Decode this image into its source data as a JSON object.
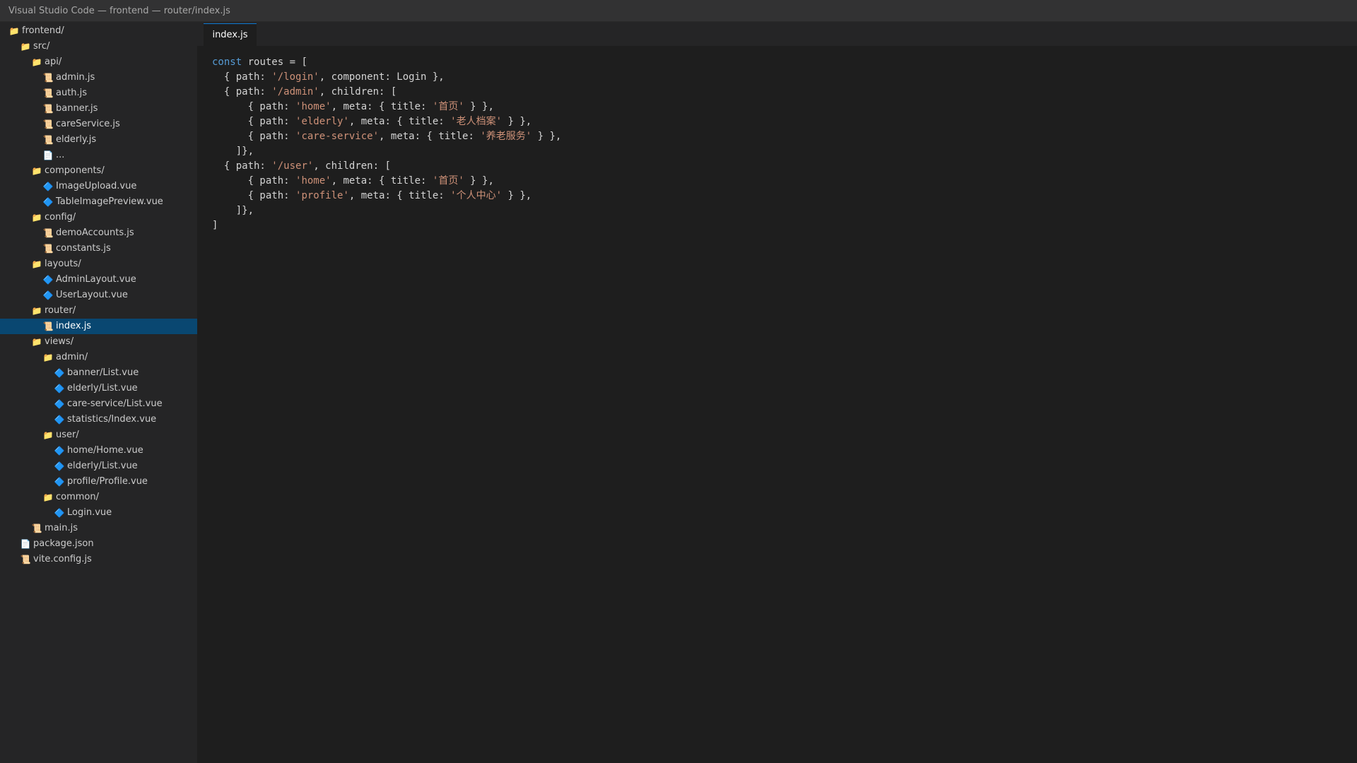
{
  "window": {
    "title": "Visual Studio Code — frontend — router/index.js"
  },
  "explorer": {
    "items": [
      {
        "label": "frontend/",
        "icon": "folder-icon",
        "depth": 0
      },
      {
        "label": "src/",
        "icon": "folder-icon",
        "depth": 1
      },
      {
        "label": "api/",
        "icon": "folder-icon",
        "depth": 2
      },
      {
        "label": "admin.js",
        "icon": "js-file-icon",
        "depth": 3
      },
      {
        "label": "auth.js",
        "icon": "js-file-icon",
        "depth": 3
      },
      {
        "label": "banner.js",
        "icon": "js-file-icon",
        "depth": 3
      },
      {
        "label": "careService.js",
        "icon": "js-file-icon",
        "depth": 3
      },
      {
        "label": "elderly.js",
        "icon": "js-file-icon",
        "depth": 3
      },
      {
        "label": "...",
        "icon": "file-icon",
        "depth": 3
      },
      {
        "label": "components/",
        "icon": "folder-icon",
        "depth": 2
      },
      {
        "label": "ImageUpload.vue",
        "icon": "vue-file-icon",
        "depth": 3
      },
      {
        "label": "TableImagePreview.vue",
        "icon": "vue-file-icon",
        "depth": 3
      },
      {
        "label": "config/",
        "icon": "folder-icon",
        "depth": 2
      },
      {
        "label": "demoAccounts.js",
        "icon": "js-file-icon",
        "depth": 3
      },
      {
        "label": "constants.js",
        "icon": "js-file-icon",
        "depth": 3
      },
      {
        "label": "layouts/",
        "icon": "folder-icon",
        "depth": 2
      },
      {
        "label": "AdminLayout.vue",
        "icon": "vue-file-icon",
        "depth": 3
      },
      {
        "label": "UserLayout.vue",
        "icon": "vue-file-icon",
        "depth": 3
      },
      {
        "label": "router/",
        "icon": "folder-icon",
        "depth": 2
      },
      {
        "label": "index.js",
        "icon": "js-file-icon",
        "depth": 3,
        "selected": true
      },
      {
        "label": "views/",
        "icon": "folder-icon",
        "depth": 2
      },
      {
        "label": "admin/",
        "icon": "folder-icon",
        "depth": 3
      },
      {
        "label": "banner/List.vue",
        "icon": "vue-file-icon",
        "depth": 4
      },
      {
        "label": "elderly/List.vue",
        "icon": "vue-file-icon",
        "depth": 4
      },
      {
        "label": "care-service/List.vue",
        "icon": "vue-file-icon",
        "depth": 4
      },
      {
        "label": "statistics/Index.vue",
        "icon": "vue-file-icon",
        "depth": 4
      },
      {
        "label": "user/",
        "icon": "folder-icon",
        "depth": 3
      },
      {
        "label": "home/Home.vue",
        "icon": "vue-file-icon",
        "depth": 4
      },
      {
        "label": "elderly/List.vue",
        "icon": "vue-file-icon",
        "depth": 4
      },
      {
        "label": "profile/Profile.vue",
        "icon": "vue-file-icon",
        "depth": 4
      },
      {
        "label": "common/",
        "icon": "folder-icon",
        "depth": 3
      },
      {
        "label": "Login.vue",
        "icon": "vue-file-icon",
        "depth": 4
      },
      {
        "label": "main.js",
        "icon": "js-file-icon",
        "depth": 2
      },
      {
        "label": "package.json",
        "icon": "file-icon",
        "depth": 1
      },
      {
        "label": "vite.config.js",
        "icon": "js-file-icon",
        "depth": 1
      }
    ]
  },
  "tabs": [
    {
      "label": "index.js",
      "active": true
    }
  ],
  "code": {
    "lines": [
      [
        {
          "t": "const",
          "c": "kw"
        },
        {
          "t": " routes = ["
        }
      ],
      [
        {
          "t": "  { path: "
        },
        {
          "t": "'/login'",
          "c": "str"
        },
        {
          "t": ", component: Login },"
        }
      ],
      [
        {
          "t": "  { path: "
        },
        {
          "t": "'/admin'",
          "c": "str"
        },
        {
          "t": ", children: ["
        }
      ],
      [
        {
          "t": "      { path: "
        },
        {
          "t": "'home'",
          "c": "str"
        },
        {
          "t": ", meta: { title: "
        },
        {
          "t": "'首页'",
          "c": "str"
        },
        {
          "t": " } },"
        }
      ],
      [
        {
          "t": "      { path: "
        },
        {
          "t": "'elderly'",
          "c": "str"
        },
        {
          "t": ", meta: { title: "
        },
        {
          "t": "'老人档案'",
          "c": "str"
        },
        {
          "t": " } },"
        }
      ],
      [
        {
          "t": "      { path: "
        },
        {
          "t": "'care-service'",
          "c": "str"
        },
        {
          "t": ", meta: { title: "
        },
        {
          "t": "'养老服务'",
          "c": "str"
        },
        {
          "t": " } },"
        }
      ],
      [
        {
          "t": "    ]},"
        }
      ],
      [
        {
          "t": "  { path: "
        },
        {
          "t": "'/user'",
          "c": "str"
        },
        {
          "t": ", children: ["
        }
      ],
      [
        {
          "t": "      { path: "
        },
        {
          "t": "'home'",
          "c": "str"
        },
        {
          "t": ", meta: { title: "
        },
        {
          "t": "'首页'",
          "c": "str"
        },
        {
          "t": " } },"
        }
      ],
      [
        {
          "t": "      { path: "
        },
        {
          "t": "'profile'",
          "c": "str"
        },
        {
          "t": ", meta: { title: "
        },
        {
          "t": "'个人中心'",
          "c": "str"
        },
        {
          "t": " } },"
        }
      ],
      [
        {
          "t": "    ]},"
        }
      ],
      [
        {
          "t": "]"
        }
      ]
    ]
  }
}
